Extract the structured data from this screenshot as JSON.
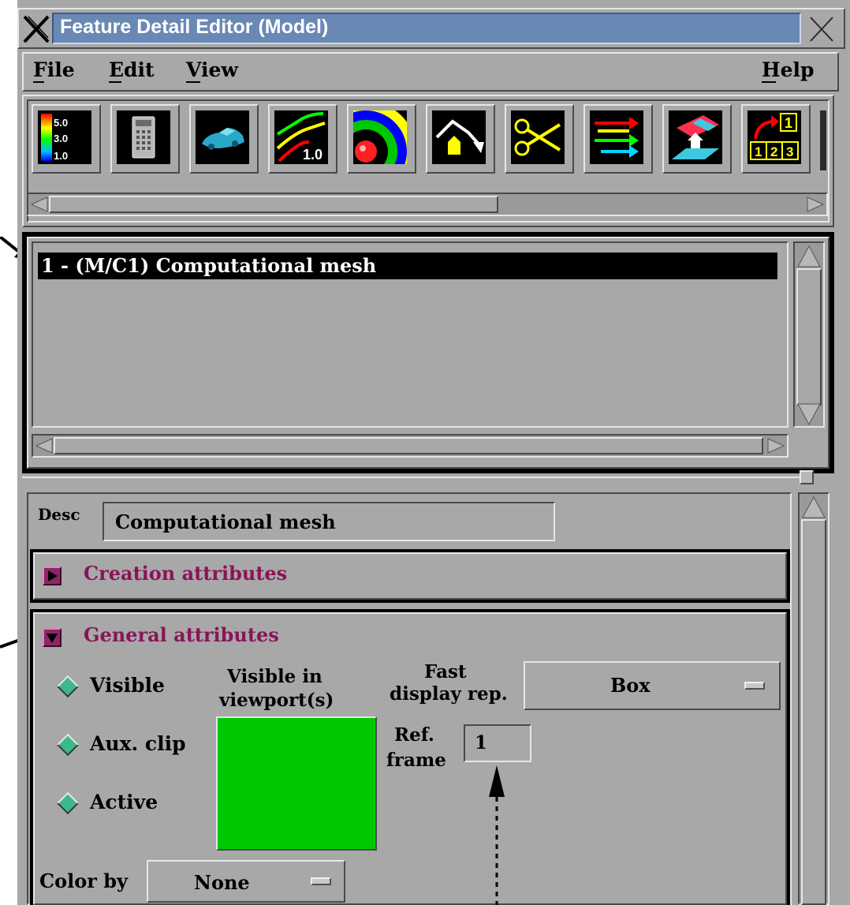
{
  "window": {
    "title": "Feature Detail Editor (Model)"
  },
  "menubar": {
    "file": "File",
    "edit": "Edit",
    "view": "View",
    "help": "Help"
  },
  "toolbar": {
    "icons": [
      {
        "name": "color-legend-icon",
        "labels": [
          "5.0",
          "3.0",
          "1.0"
        ]
      },
      {
        "name": "calculator-icon"
      },
      {
        "name": "car-model-icon"
      },
      {
        "name": "contour-line-icon",
        "label": "1.0"
      },
      {
        "name": "isosurface-icon"
      },
      {
        "name": "elevated-surface-icon"
      },
      {
        "name": "scissors-cut-icon"
      },
      {
        "name": "vector-arrows-icon"
      },
      {
        "name": "developed-surface-icon"
      },
      {
        "name": "particle-trace-icon",
        "labels": [
          "1",
          "1",
          "2",
          "3"
        ]
      }
    ]
  },
  "parts_list": {
    "items": [
      "1 - (M/C1) Computational mesh"
    ]
  },
  "desc": {
    "label": "Desc",
    "value": "Computational mesh"
  },
  "creation": {
    "label": "Creation attributes"
  },
  "general": {
    "label": "General attributes",
    "visible": "Visible",
    "aux_clip": "Aux. clip",
    "active": "Active",
    "visible_in_line1": "Visible in",
    "visible_in_line2": "viewport(s)",
    "fast_line1": "Fast",
    "fast_line2": "display rep.",
    "fast_value": "Box",
    "ref_line1": "Ref.",
    "ref_line2": "frame",
    "ref_value": "1",
    "color_by_label": "Color by",
    "color_by_value": "None"
  },
  "colors": {
    "title_bar": "#6a88b4",
    "panel": "#a8a8a8",
    "viewport_green": "#00c800",
    "section_purple": "#8a1458"
  }
}
